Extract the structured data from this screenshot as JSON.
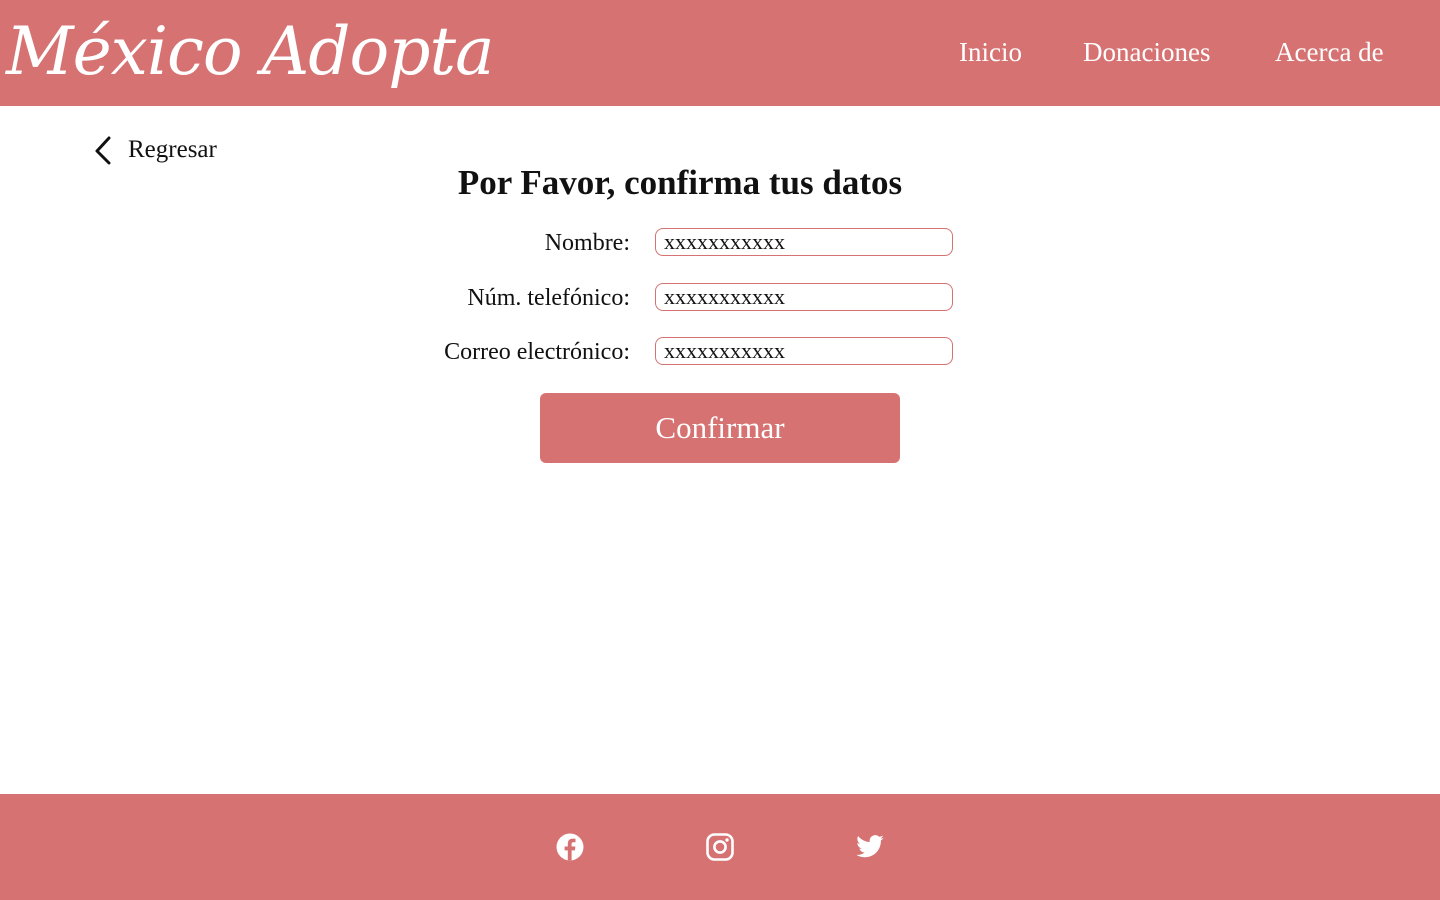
{
  "colors": {
    "brand": "#d67272",
    "text": "#111111",
    "background": "#ffffff",
    "on_brand": "#ffffff"
  },
  "header": {
    "logo_text": "México Adopta",
    "nav": [
      {
        "label": "Inicio"
      },
      {
        "label": "Donaciones"
      },
      {
        "label": "Acerca de"
      }
    ]
  },
  "back": {
    "label": "Regresar",
    "icon": "chevron-left-icon"
  },
  "main": {
    "title": "Por Favor, confirma tus datos",
    "fields": [
      {
        "label": "Nombre:",
        "value": "xxxxxxxxxxx"
      },
      {
        "label": "Núm. telefónico:",
        "value": "xxxxxxxxxxx"
      },
      {
        "label": "Correo electrónico:",
        "value": "xxxxxxxxxxx"
      }
    ],
    "confirm_label": "Confirmar"
  },
  "footer": {
    "icons": [
      "facebook-icon",
      "instagram-icon",
      "twitter-icon"
    ]
  }
}
